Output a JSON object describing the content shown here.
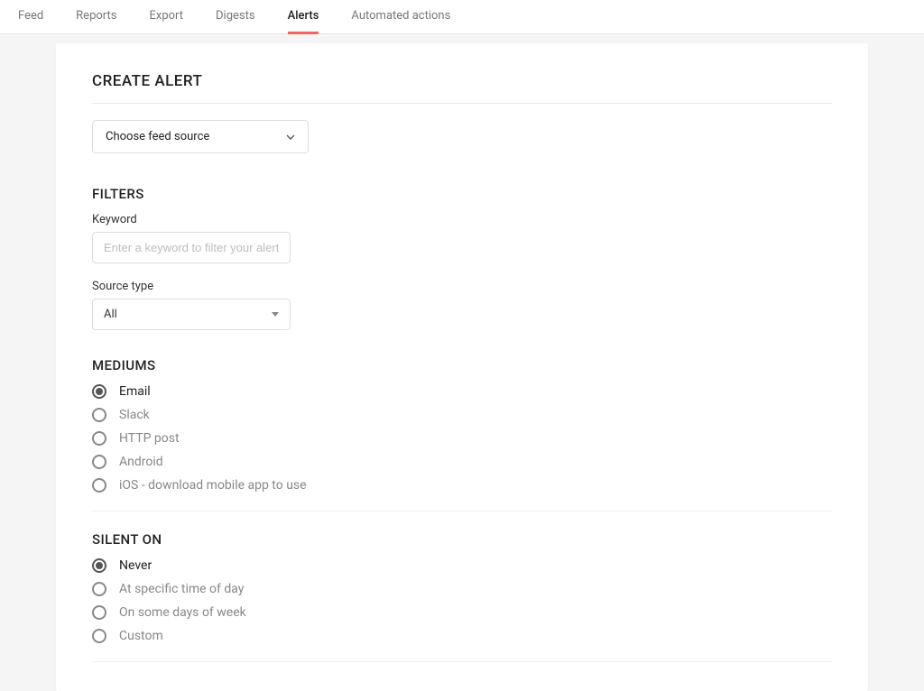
{
  "tabs": {
    "items": [
      {
        "label": "Feed",
        "active": false
      },
      {
        "label": "Reports",
        "active": false
      },
      {
        "label": "Export",
        "active": false
      },
      {
        "label": "Digests",
        "active": false
      },
      {
        "label": "Alerts",
        "active": true
      },
      {
        "label": "Automated actions",
        "active": false
      }
    ]
  },
  "page": {
    "title": "CREATE ALERT"
  },
  "feedSource": {
    "placeholder": "Choose feed source"
  },
  "filters": {
    "heading": "FILTERS",
    "keyword": {
      "label": "Keyword",
      "placeholder": "Enter a keyword to filter your alerts"
    },
    "sourceType": {
      "label": "Source type",
      "value": "All"
    }
  },
  "mediums": {
    "heading": "MEDIUMS",
    "options": [
      {
        "label": "Email",
        "selected": true
      },
      {
        "label": "Slack",
        "selected": false
      },
      {
        "label": "HTTP post",
        "selected": false
      },
      {
        "label": "Android",
        "selected": false
      },
      {
        "label": "iOS - download mobile app to use",
        "selected": false
      }
    ]
  },
  "silent": {
    "heading": "SILENT ON",
    "options": [
      {
        "label": "Never",
        "selected": true
      },
      {
        "label": "At specific time of day",
        "selected": false
      },
      {
        "label": "On some days of week",
        "selected": false
      },
      {
        "label": "Custom",
        "selected": false
      }
    ]
  }
}
